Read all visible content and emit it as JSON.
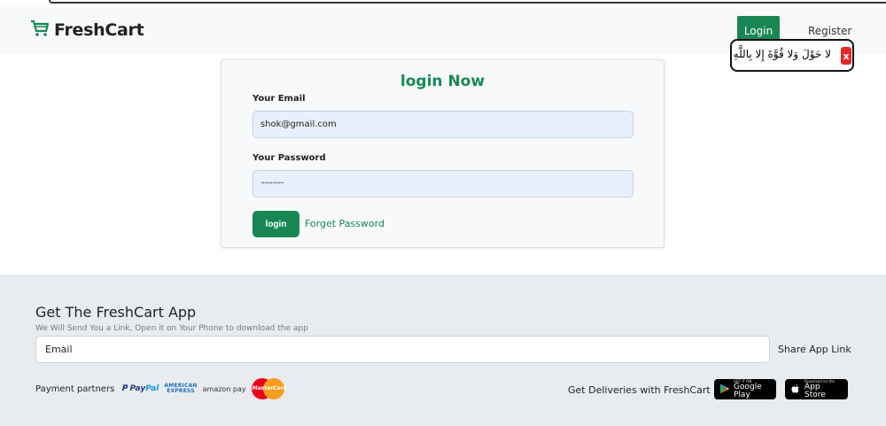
{
  "colors": {
    "brand_green": "#198754",
    "card_bg": "#f8f9fa",
    "footer_bg": "#e9ecef",
    "input_bg": "#e8f0fe"
  },
  "navbar": {
    "brand": "FreshCart",
    "brand_icon": "cart-icon",
    "login_label": "Login",
    "register_label": "Register"
  },
  "popup": {
    "text": "لا حَوْلَ وَلا قُوَّةَ إِلا بِاللَّهِ",
    "close_label": "x"
  },
  "login_form": {
    "title": "login Now",
    "email_label": "Your Email",
    "email_value": "shok@gmail.com",
    "password_label": "Your Password",
    "password_value": "············",
    "submit_label": "login",
    "forget_label": "Forget Password"
  },
  "footer": {
    "title": "Get The FreshCart App",
    "subtitle": "We Will Send You a Link, Open it on Your Phone to download the app",
    "email_placeholder": "Email",
    "share_label": "Share App Link",
    "partners_label": "Payment partners",
    "partners": {
      "paypal_a": "Pay",
      "paypal_b": "Pal",
      "amex_line1": "AMERICAN",
      "amex_line2": "EXPRESS",
      "amazon": "amazon pay",
      "mastercard": "MasterCard"
    },
    "deliveries_label": "Get Deliveries with FreshCart",
    "google_play": {
      "small": "GET IT ON",
      "big": "Google Play"
    },
    "app_store": {
      "small": "Download on the",
      "big": "App Store"
    }
  }
}
